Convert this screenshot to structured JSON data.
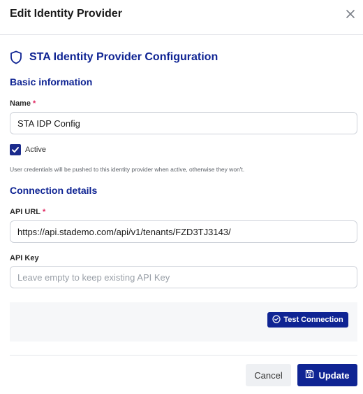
{
  "dialog": {
    "title": "Edit Identity Provider",
    "close_icon": "close-icon"
  },
  "config": {
    "heading": "STA Identity Provider Configuration",
    "heading_icon": "shield-icon",
    "accent_color": "#0f2493"
  },
  "basic": {
    "heading": "Basic information",
    "name_label": "Name",
    "required_mark": "*",
    "name_value": "STA IDP Config",
    "active_label": "Active",
    "active_checked": true,
    "hint": "User credentials will be pushed to this identity provider when active, otherwise they won't."
  },
  "connection": {
    "heading": "Connection details",
    "api_url_label": "API URL",
    "required_mark": "*",
    "api_url_value": "https://api.stademo.com/api/v1/tenants/FZD3TJ3143/",
    "api_key_label": "API Key",
    "api_key_placeholder": "Leave empty to keep existing API Key",
    "test_button": "Test Connection",
    "test_icon": "check-circle-icon"
  },
  "footer": {
    "cancel": "Cancel",
    "update": "Update",
    "update_icon": "save-icon"
  }
}
